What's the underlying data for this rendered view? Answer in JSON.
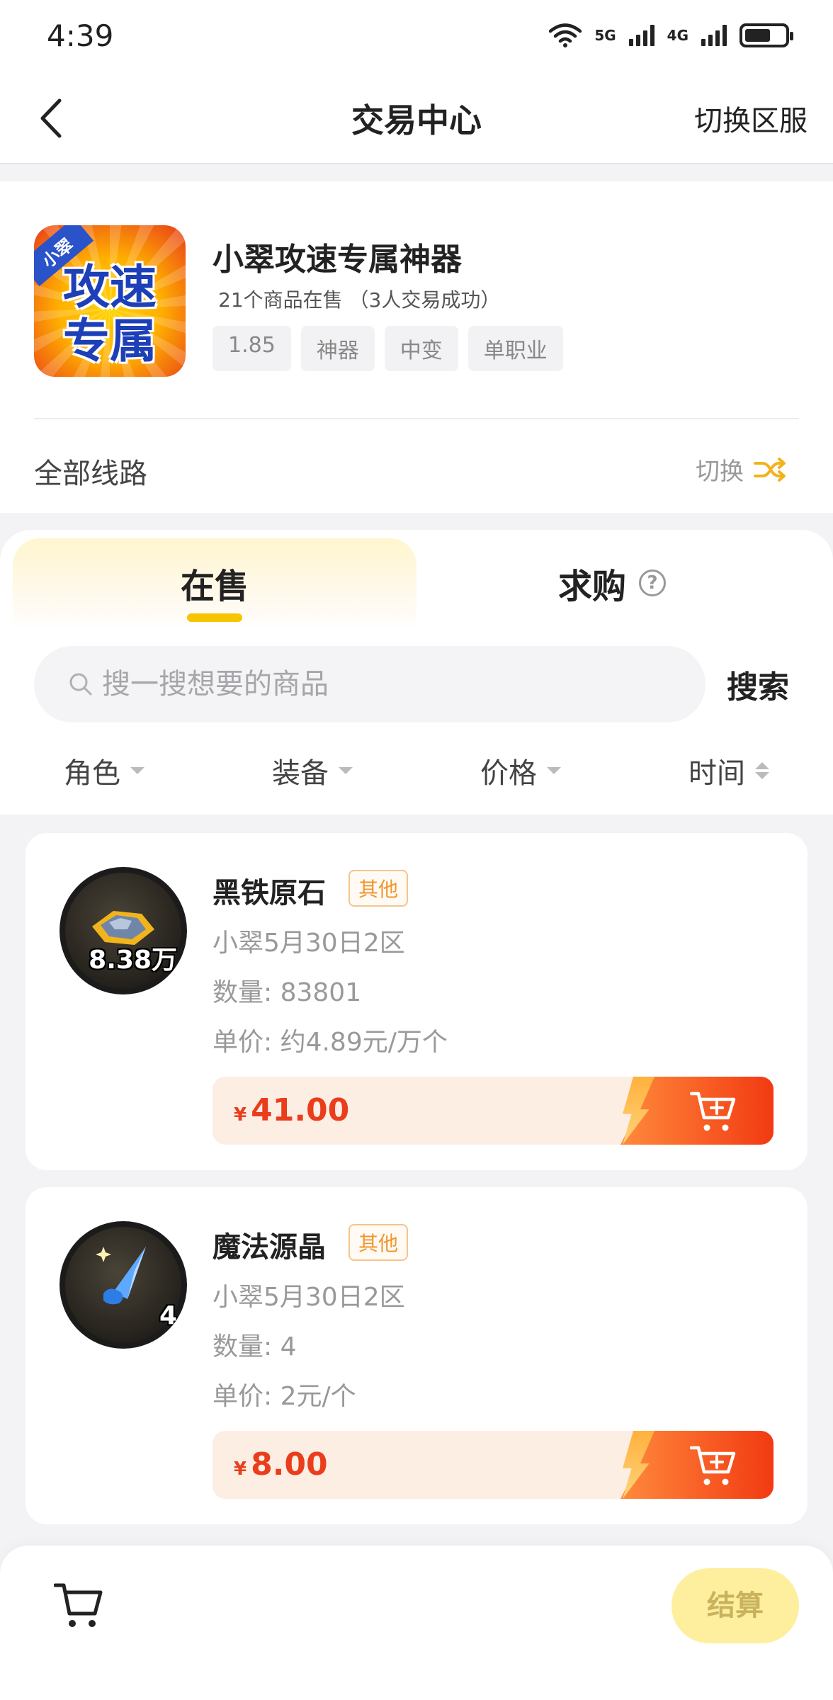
{
  "status_bar": {
    "time": "4:39",
    "net1": "5G",
    "net2": "4G"
  },
  "header": {
    "title": "交易中心",
    "switch_server": "切换区服"
  },
  "game": {
    "name": "小翠攻速专属神器",
    "stats": "21个商品在售 （3人交易成功）",
    "logo": {
      "tag": "小翠",
      "line1": "攻速",
      "line2": "专属"
    },
    "tags": [
      "1.85",
      "神器",
      "中变",
      "单职业"
    ],
    "route_label": "全部线路",
    "route_switch": "切换"
  },
  "tabs": {
    "sell": "在售",
    "buy": "求购",
    "help": "?"
  },
  "search": {
    "placeholder": "搜一搜想要的商品",
    "value": "",
    "button": "搜索"
  },
  "filters": [
    "角色",
    "装备",
    "价格",
    "时间"
  ],
  "products": [
    {
      "name": "黑铁原石",
      "badge": "其他",
      "server": "小翠5月30日2区",
      "quantity": "数量: 83801",
      "unit_price": "单价: 约4.89元/万个",
      "price": "41.00",
      "thumb_qty": "8.38万",
      "icon": "iron-ore-icon"
    },
    {
      "name": "魔法源晶",
      "badge": "其他",
      "server": "小翠5月30日2区",
      "quantity": "数量: 4",
      "unit_price": "单价: 2元/个",
      "price": "8.00",
      "thumb_qty": "4",
      "icon": "magic-crystal-icon"
    }
  ],
  "currency_symbol": "¥",
  "bottom": {
    "checkout": "结算"
  },
  "colors": {
    "accent": "#f6c400",
    "price": "#ea3d1c",
    "badge": "#f0962e",
    "checkout_bg": "#fdef9d"
  }
}
